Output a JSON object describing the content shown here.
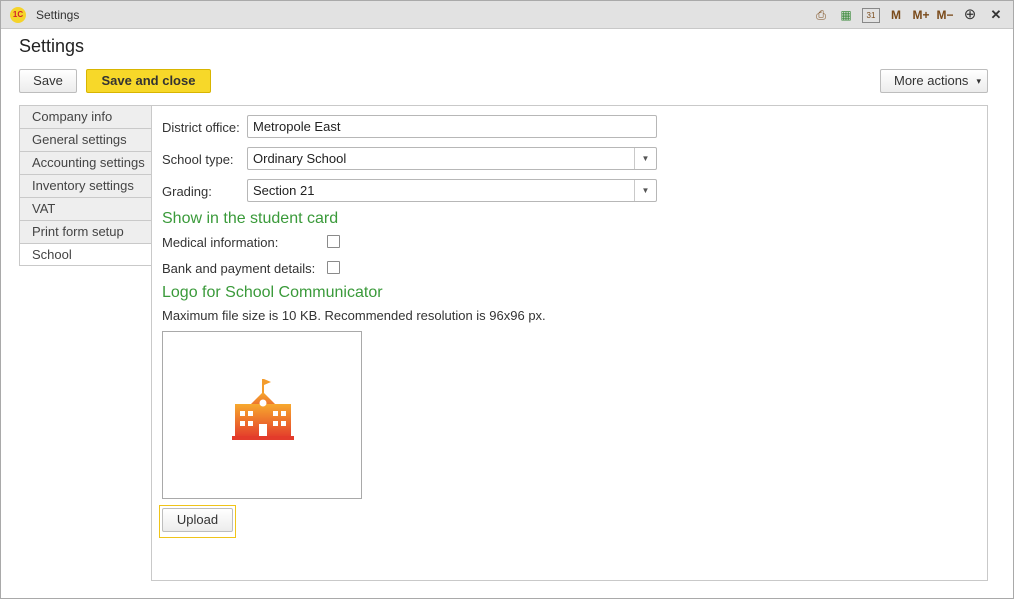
{
  "window": {
    "title": "Settings",
    "app_logo_text": "1C",
    "toolbar_icons": [
      {
        "name": "print-icon",
        "glyph": "⎙"
      },
      {
        "name": "calculator-icon",
        "glyph": "▦"
      },
      {
        "name": "calendar-icon",
        "glyph": "31"
      },
      {
        "name": "memory-m-icon",
        "glyph": "M"
      },
      {
        "name": "memory-plus-icon",
        "glyph": "M+"
      },
      {
        "name": "memory-minus-icon",
        "glyph": "M−"
      },
      {
        "name": "zoom-icon",
        "glyph": "⊕"
      },
      {
        "name": "close-icon",
        "glyph": "✕"
      }
    ]
  },
  "page": {
    "title": "Settings"
  },
  "toolbar": {
    "save_label": "Save",
    "save_close_label": "Save and close",
    "more_actions_label": "More actions",
    "more_actions_chevron": "▾"
  },
  "tabs": [
    {
      "label": "Company info"
    },
    {
      "label": "General settings"
    },
    {
      "label": "Accounting settings"
    },
    {
      "label": "Inventory settings"
    },
    {
      "label": "VAT"
    },
    {
      "label": "Print form setup"
    },
    {
      "label": "School",
      "active": true
    }
  ],
  "form": {
    "district_office": {
      "label": "District office:",
      "value": "Metropole East"
    },
    "school_type": {
      "label": "School type:",
      "value": "Ordinary School"
    },
    "grading": {
      "label": "Grading:",
      "value": "Section 21"
    },
    "dropdown_arrow": "▼",
    "student_card": {
      "title": "Show in the student card",
      "medical_label": "Medical information:",
      "medical_checked": false,
      "bank_label": "Bank and payment details:",
      "bank_checked": false
    },
    "logo": {
      "title": "Logo for School Communicator",
      "note": "Maximum file size is 10 KB. Recommended resolution is 96x96 px.",
      "image_icon": "school-building-icon",
      "upload_label": "Upload"
    }
  },
  "colors": {
    "accent_yellow": "#f7d829",
    "section_green": "#3a9a3a",
    "logo_orange": "#f39c2c",
    "logo_red": "#e53b2c"
  }
}
